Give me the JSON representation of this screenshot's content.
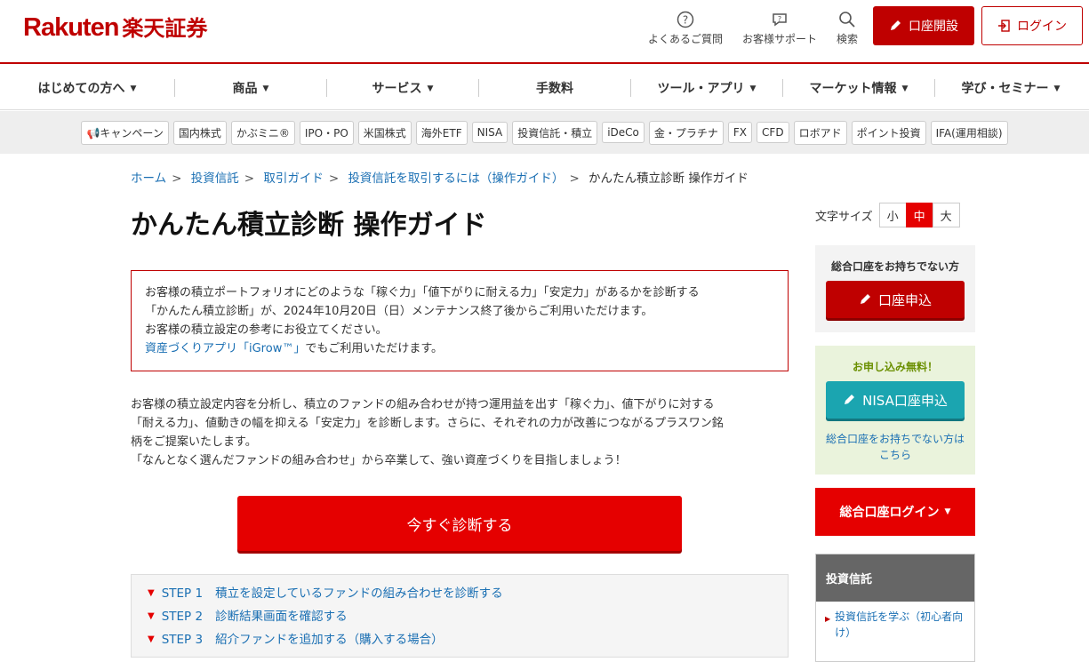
{
  "header": {
    "logo_en": "Rakuten",
    "logo_jp": "楽天証券",
    "faq_label": "よくあるご質問",
    "support_label": "お客様サポート",
    "search_label": "検索",
    "open_account_label": "口座開設",
    "login_label": "ログイン"
  },
  "nav": {
    "items": [
      {
        "label": "はじめての方へ",
        "caret": "▼"
      },
      {
        "label": "商品",
        "caret": "▼"
      },
      {
        "label": "サービス",
        "caret": "▼"
      },
      {
        "label": "手数料",
        "caret": ""
      },
      {
        "label": "ツール・アプリ",
        "caret": "▼"
      },
      {
        "label": "マーケット情報",
        "caret": "▼"
      },
      {
        "label": "学び・セミナー",
        "caret": "▼"
      }
    ]
  },
  "tags": [
    "キャンペーン",
    "国内株式",
    "かぶミニ®",
    "IPO・PO",
    "米国株式",
    "海外ETF",
    "NISA",
    "投資信託・積立",
    "iDeCo",
    "金・プラチナ",
    "FX",
    "CFD",
    "ロボアド",
    "ポイント投資",
    "IFA(運用相談)"
  ],
  "breadcrumb": {
    "items": [
      "ホーム",
      "投資信託",
      "取引ガイド",
      "投資信託を取引するには（操作ガイド）"
    ],
    "current": "かんたん積立診断 操作ガイド",
    "sep": ">"
  },
  "page": {
    "title": "かんたん積立診断 操作ガイド"
  },
  "notice": {
    "line1": "お客様の積立ポートフォリオにどのような「稼ぐ力」「値下がりに耐える力」「安定力」があるかを診断する",
    "line2": "「かんたん積立診断」が、2024年10月20日（日）メンテナンス終了後からご利用いただけます。",
    "line3": "お客様の積立設定の参考にお役立てください。",
    "link": "資産づくりアプリ「iGrow™」",
    "line4_tail": "でもご利用いただけます。"
  },
  "description": {
    "line1": "お客様の積立設定内容を分析し、積立のファンドの組み合わせが持つ運用益を出す「稼ぐ力」、値下がりに対する",
    "line2": "「耐える力」、値動きの幅を抑える「安定力」を診断します。さらに、それぞれの力が改善につながるプラスワン銘",
    "line3": "柄をご提案いたします。",
    "line4": "「なんとなく選んだファンドの組み合わせ」から卒業して、強い資産づくりを目指しましょう！"
  },
  "cta": {
    "label": "今すぐ診断する"
  },
  "steps": [
    {
      "num": "STEP 1",
      "text": "積立を設定しているファンドの組み合わせを診断する"
    },
    {
      "num": "STEP 2",
      "text": "診断結果画面を確認する"
    },
    {
      "num": "STEP 3",
      "text": "紹介ファンドを追加する（購入する場合）"
    }
  ],
  "font_size": {
    "label": "文字サイズ",
    "small": "小",
    "medium": "中",
    "large": "大",
    "selected": "中"
  },
  "sidebar": {
    "box1_title": "総合口座をお持ちでない方",
    "box1_button": "口座申込",
    "box2_title": "お申し込み無料！",
    "box2_button": "NISA口座申込",
    "box2_link": "総合口座をお持ちでない方は こちら",
    "login_button": "総合口座ログイン",
    "login_caret": "▼",
    "menu_header": "投資信託",
    "menu_item": "投資信託を学ぶ（初心者向け）"
  },
  "colors": {
    "brand_red": "#bf0000",
    "cta_red": "#e50000",
    "link_blue": "#1a6fb3",
    "teal": "#1ba5b0"
  }
}
